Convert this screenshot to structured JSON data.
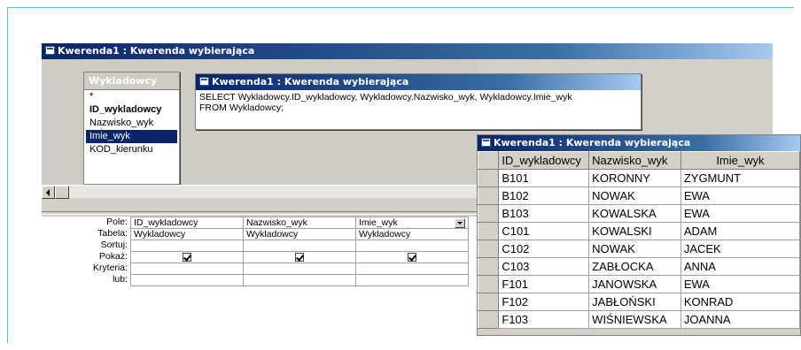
{
  "main_window": {
    "title": "Kwerenda1 : Kwerenda wybierająca"
  },
  "field_list": {
    "title": "Wykladowcy",
    "items": [
      "*",
      "ID_wykladowcy",
      "Nazwisko_wyk",
      "Imie_wyk",
      "KOD_kierunku"
    ]
  },
  "sql_window": {
    "title": "Kwerenda1 : Kwerenda wybierająca",
    "sql": "SELECT Wykladowcy.ID_wykladowcy, Wykladowcy.Nazwisko_wyk, Wykladowcy.Imie_wyk\nFROM Wykladowcy;"
  },
  "design_grid": {
    "row_labels": [
      "Pole:",
      "Tabela:",
      "Sortuj:",
      "Pokaż:",
      "Kryteria:",
      "lub:"
    ],
    "columns": [
      {
        "field": "ID_wykladowcy",
        "table": "Wykladowcy"
      },
      {
        "field": "Nazwisko_wyk",
        "table": "Wykladowcy"
      },
      {
        "field": "Imie_wyk",
        "table": "Wykladowcy"
      }
    ]
  },
  "datasheet": {
    "title": "Kwerenda1 : Kwerenda wybierająca",
    "headers": [
      "ID_wykladowcy",
      "Nazwisko_wyk",
      "Imie_wyk"
    ],
    "rows": [
      [
        "B101",
        "KORONNY",
        "ZYGMUNT"
      ],
      [
        "B102",
        "NOWAK",
        "EWA"
      ],
      [
        "B103",
        "KOWALSKA",
        "EWA"
      ],
      [
        "C101",
        "KOWALSKI",
        "ADAM"
      ],
      [
        "C102",
        "NOWAK",
        "JACEK"
      ],
      [
        "C103",
        "ZABŁOCKA",
        "ANNA"
      ],
      [
        "F101",
        "JANOWSKA",
        "EWA"
      ],
      [
        "F102",
        "JABŁOŃSKI",
        "KONRAD"
      ],
      [
        "F103",
        "WIŚNIEWSKA",
        "JOANNA"
      ]
    ]
  }
}
